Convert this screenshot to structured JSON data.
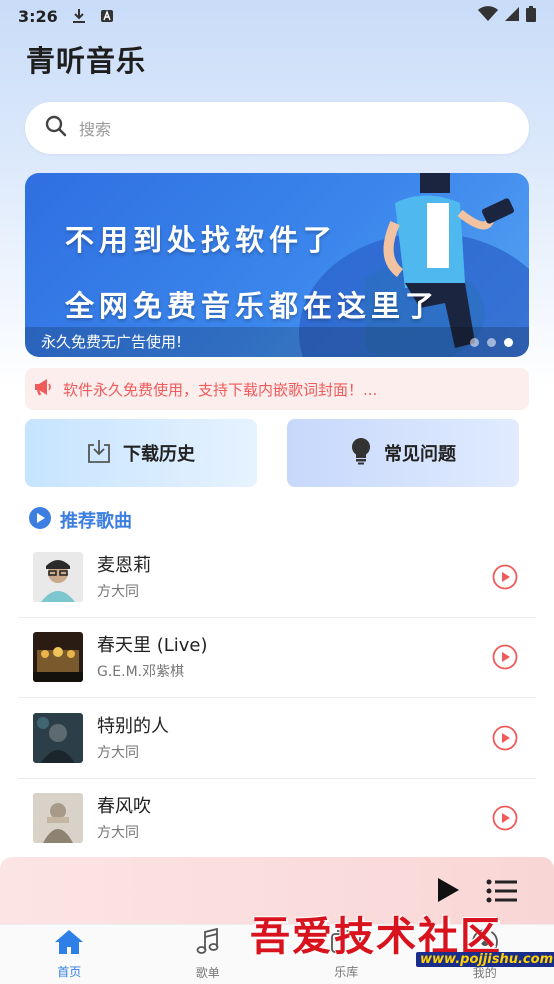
{
  "status_bar": {
    "time": "3:26"
  },
  "app": {
    "title": "青听音乐"
  },
  "search": {
    "placeholder": "搜索"
  },
  "banner": {
    "line1": "不用到处找软件了",
    "line2": "全网免费音乐都在这里了",
    "caption": "永久免费无广告使用!",
    "dots": 3,
    "active_dot": 3
  },
  "notice": {
    "text": "软件永久免费使用，支持下载内嵌歌词封面！..."
  },
  "quick_actions": [
    {
      "label": "下载历史",
      "icon": "download-icon"
    },
    {
      "label": "常见问题",
      "icon": "lightbulb-icon"
    }
  ],
  "section": {
    "title": "推荐歌曲"
  },
  "songs": [
    {
      "name": "麦恩莉",
      "artist": "方大同"
    },
    {
      "name": "春天里 (Live)",
      "artist": "G.E.M.邓紫棋"
    },
    {
      "name": "特别的人",
      "artist": "方大同"
    },
    {
      "name": "春风吹",
      "artist": "方大同"
    }
  ],
  "tabs": [
    {
      "label": "首页",
      "icon": "home-icon",
      "active": true
    },
    {
      "label": "歌单",
      "icon": "music-note-icon",
      "active": false
    },
    {
      "label": "乐库",
      "icon": "library-icon",
      "active": false
    },
    {
      "label": "我的",
      "icon": "profile-icon",
      "active": false
    }
  ],
  "watermark": {
    "text": "吾爱技术社区",
    "url": "www.pojjishu.com"
  },
  "colors": {
    "accent": "#2e7fe8",
    "play_red": "#ef5a5a",
    "notice_bg": "#fdeeee"
  }
}
